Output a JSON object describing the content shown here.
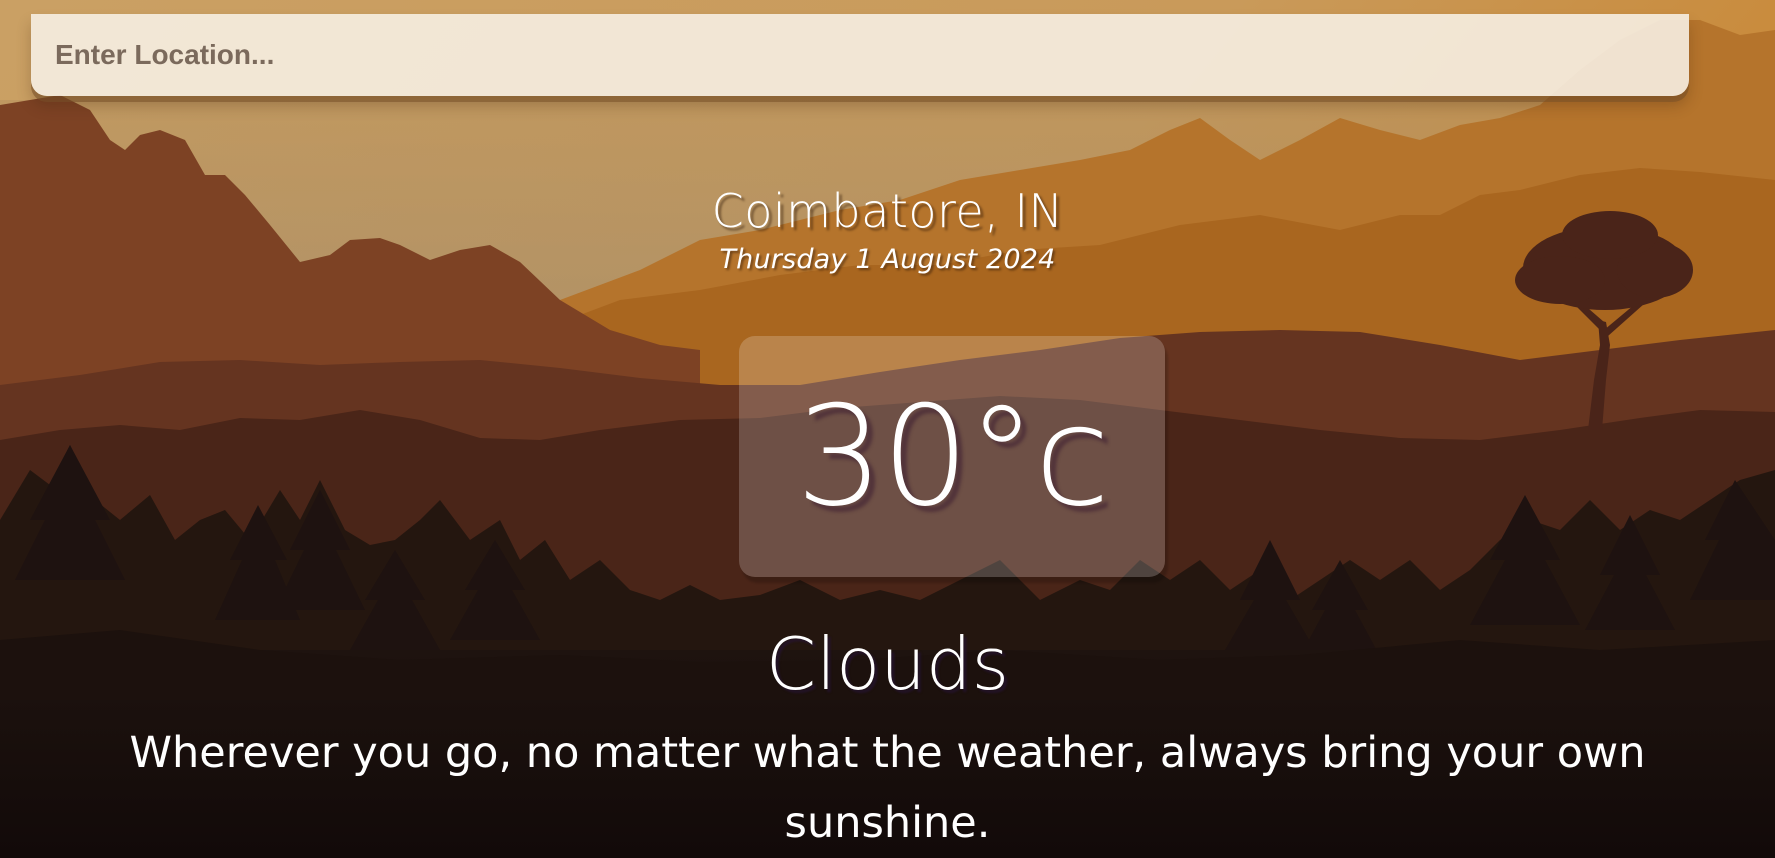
{
  "search": {
    "placeholder": "Enter Location...",
    "value": ""
  },
  "location": {
    "city": "Coimbatore, IN",
    "date": "Thursday 1 August 2024"
  },
  "weather": {
    "temperature": "30°c",
    "condition": "Clouds"
  },
  "quote": "Wherever you go, no matter what the weather, always bring your own sunshine.",
  "colors": {
    "sky_top": "#c98f45",
    "sky_right": "#c8862f",
    "far_hills": "#b5762e",
    "mid_mountain": "#7d4224",
    "near_hills": "#552a19",
    "forest": "#1d1210",
    "ground": "#150c0a",
    "tree": "#4a251a"
  }
}
